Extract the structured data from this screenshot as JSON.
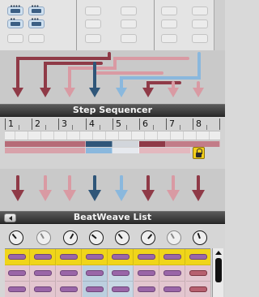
{
  "sequencer": {
    "title": "Step Sequencer",
    "steps": [
      "1",
      "2",
      "3",
      "4",
      "5",
      "6",
      "7",
      "8"
    ],
    "lock_icon": "lock-icon"
  },
  "beatweave": {
    "title": "BeatWeave List",
    "back_icon": "chevron-left-icon"
  },
  "colors": {
    "dark_red": "#8f3a47",
    "pink": "#d99aa3",
    "dark_blue": "#2f5679",
    "light_blue": "#8ab8dd",
    "highlight_yellow": "#f0d51a",
    "purple_pad": "#9a66a8"
  },
  "arrow_colors": [
    "dark_red",
    "pink",
    "pink",
    "dark_blue",
    "light_blue",
    "dark_red",
    "pink",
    "dark_red"
  ]
}
